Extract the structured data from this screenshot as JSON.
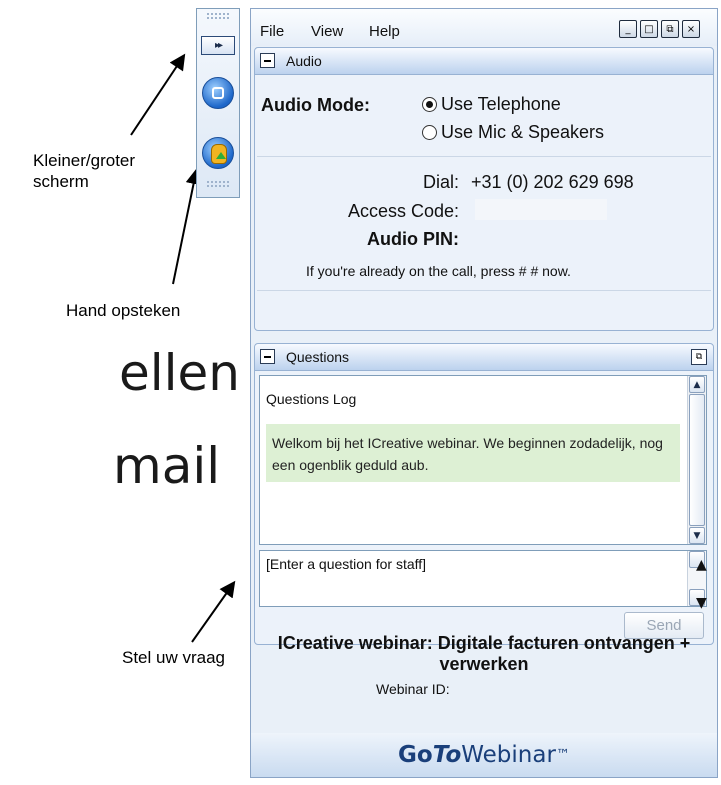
{
  "slide_background": {
    "line1": "ellen",
    "line2": "mail"
  },
  "annotations": {
    "resize": "Kleiner/groter\nscherm",
    "raise_hand": "Hand opsteken",
    "ask_question": "Stel uw vraag"
  },
  "toolbar": {
    "expand_glyph": "▸▸"
  },
  "menu": {
    "file": "File",
    "view": "View",
    "help": "Help"
  },
  "window_controls": {
    "minimize": "_",
    "maximize": "□",
    "restore": "⧉",
    "close": "×"
  },
  "audio": {
    "panel_title": "Audio",
    "mode_label": "Audio Mode:",
    "options": [
      "Use Telephone",
      "Use Mic & Speakers"
    ],
    "selected_option": "Use Telephone",
    "dial_label": "Dial:",
    "dial_number": "+31 (0) 202 629 698",
    "access_code_label": "Access Code:",
    "pin_label": "Audio PIN:",
    "hint": "If you're already on the call, press #   # now."
  },
  "questions": {
    "panel_title": "Questions",
    "log_title": "Questions Log",
    "welcome_message": "Welkom bij het ICreative webinar. We beginnen zodadelijk, nog een ogenblik geduld aub.",
    "input_placeholder": "[Enter a question for staff]",
    "send_label": "Send"
  },
  "webinar": {
    "title": "ICreative webinar: Digitale facturen ontvangen + verwerken",
    "id_label": "Webinar ID:"
  },
  "brand": {
    "go": "Go",
    "to": "To",
    "webinar": "Webinar",
    "tm": "™"
  },
  "colors": {
    "accent": "#1c66c9",
    "brand_text": "#1a3f7a",
    "welcome_bg": "#ddf0d4"
  }
}
